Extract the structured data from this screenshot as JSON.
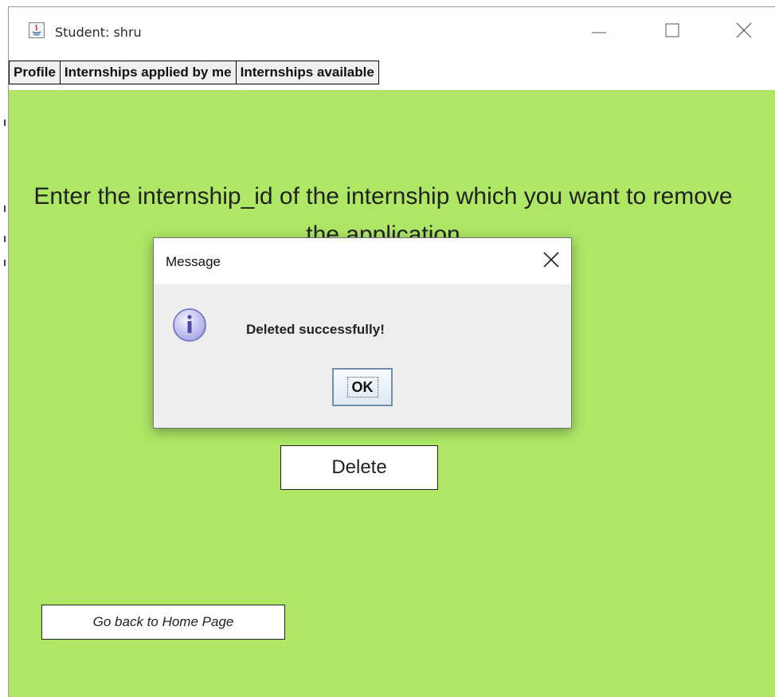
{
  "window": {
    "title": "Student: shru",
    "icon": "java-app-icon",
    "controls": [
      "minimize-icon",
      "maximize-icon",
      "close-icon"
    ]
  },
  "tabs": [
    {
      "label": "Profile"
    },
    {
      "label": "Internships applied by me"
    },
    {
      "label": "Internships available"
    }
  ],
  "content": {
    "background": "#ade765",
    "prompt": "Enter the internship_id of the internship which you want to remove the application",
    "delete_label": "Delete",
    "home_label": "Go back to Home Page"
  },
  "dialog": {
    "title": "Message",
    "icon": "info-icon",
    "message": "Deleted successfully!",
    "ok_label": "OK"
  }
}
